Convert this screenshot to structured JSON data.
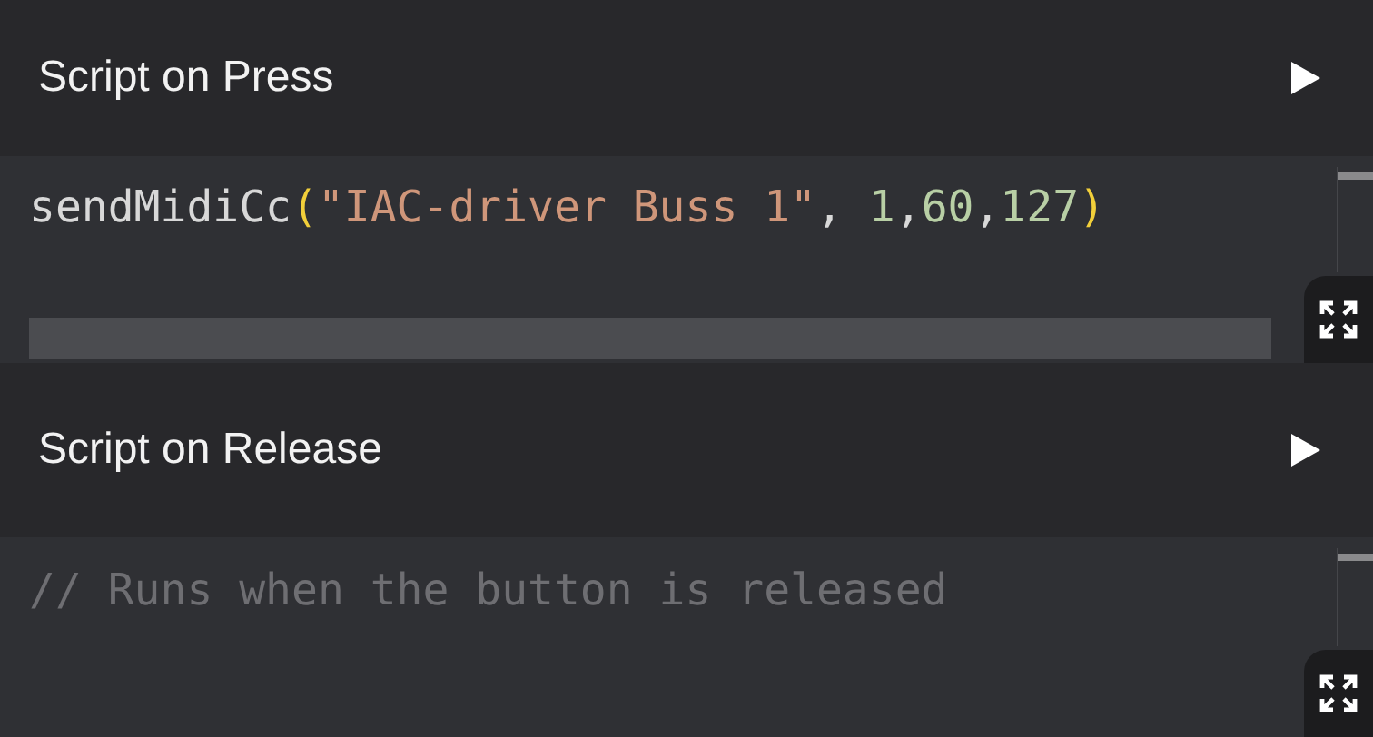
{
  "sections": [
    {
      "title": "Script on Press",
      "horizontal_scrollbar": true,
      "code": [
        {
          "kind": "function",
          "text": "sendMidiCc"
        },
        {
          "kind": "bracket",
          "text": "("
        },
        {
          "kind": "string",
          "text": "\"IAC-driver Buss 1\""
        },
        {
          "kind": "punct",
          "text": ", "
        },
        {
          "kind": "number",
          "text": "1"
        },
        {
          "kind": "punct",
          "text": ","
        },
        {
          "kind": "number",
          "text": "60"
        },
        {
          "kind": "punct",
          "text": ","
        },
        {
          "kind": "number",
          "text": "127"
        },
        {
          "kind": "bracket",
          "text": ")"
        }
      ]
    },
    {
      "title": "Script on Release",
      "horizontal_scrollbar": false,
      "code": [
        {
          "kind": "comment",
          "text": "// Runs when the button is released"
        }
      ]
    }
  ]
}
